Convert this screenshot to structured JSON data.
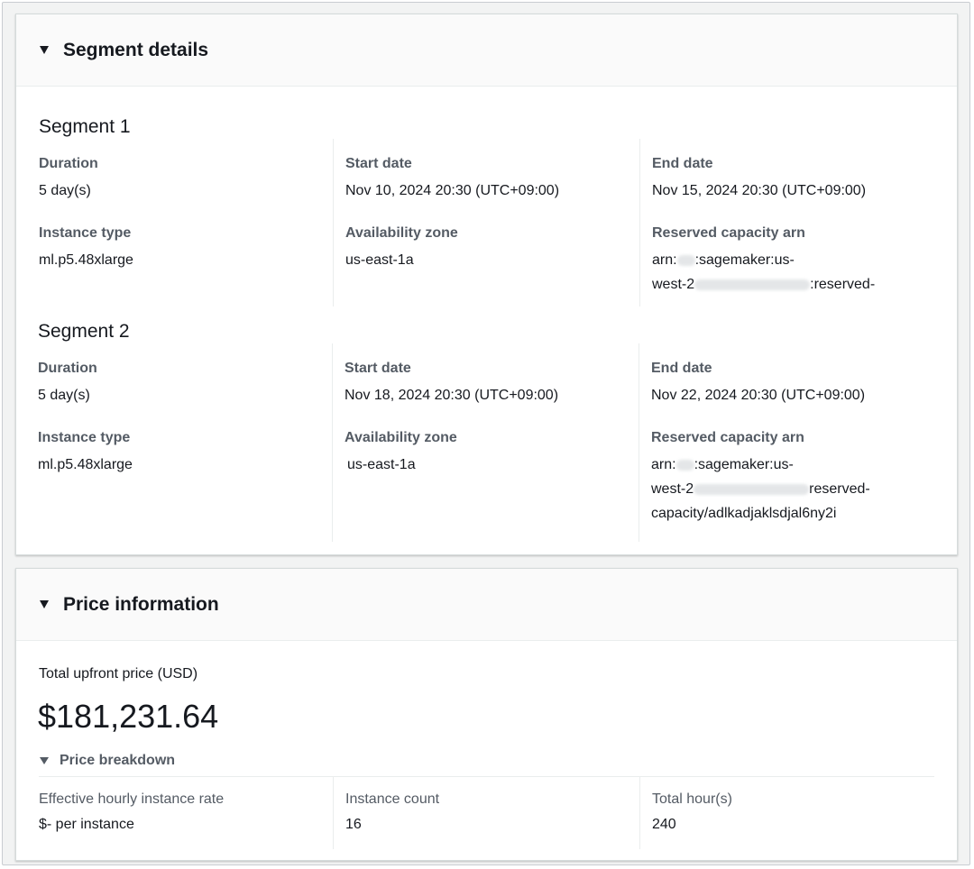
{
  "segment_card": {
    "title": "Segment details",
    "segments": [
      {
        "title": "Segment 1",
        "duration_label": "Duration",
        "duration": "5 day(s)",
        "start_label": "Start date",
        "start": "Nov 10, 2024 20:30 (UTC+09:00)",
        "end_label": "End date",
        "end": "Nov 15, 2024 20:30 (UTC+09:00)",
        "instance_label": "Instance type",
        "instance": "ml.p5.48xlarge",
        "az_label": "Availability zone",
        "az": "us-east-1a",
        "arn_label": "Reserved capacity arn",
        "arn_line1_a": "arn:",
        "arn_line1_b": ":sagemaker:us-",
        "arn_line2_a": "west-2",
        "arn_line2_b": ":reserved-",
        "arn_line3": ""
      },
      {
        "title": "Segment 2",
        "duration_label": "Duration",
        "duration": "5 day(s)",
        "start_label": "Start date",
        "start": "Nov 18, 2024 20:30 (UTC+09:00)",
        "end_label": "End date",
        "end": "Nov 22, 2024 20:30 (UTC+09:00)",
        "instance_label": "Instance type",
        "instance": "ml.p5.48xlarge",
        "az_label": "Availability zone",
        "az": "us-east-1a",
        "arn_label": "Reserved capacity arn",
        "arn_line1_a": "arn:",
        "arn_line1_b": ":sagemaker:us-",
        "arn_line2_a": "west-2",
        "arn_line2_b": "reserved-",
        "arn_line3": "capacity/adlkadjaklsdjal6ny2i"
      }
    ]
  },
  "price_card": {
    "title": "Price information",
    "total_label": "Total upfront price (USD)",
    "total_value": "$181,231.64",
    "breakdown_label": "Price breakdown",
    "rate_label": "Effective hourly instance rate",
    "rate_value": "$- per instance",
    "count_label": "Instance count",
    "count_value": "16",
    "hours_label": "Total hour(s)",
    "hours_value": "240"
  },
  "icons": {
    "section_toggle": "caret-down-icon",
    "breakdown_toggle": "caret-down-icon"
  },
  "colors": {
    "label": "#545b64",
    "text": "#16191f",
    "header_bg": "#fafafa",
    "page_bg": "#f2f3f3"
  }
}
